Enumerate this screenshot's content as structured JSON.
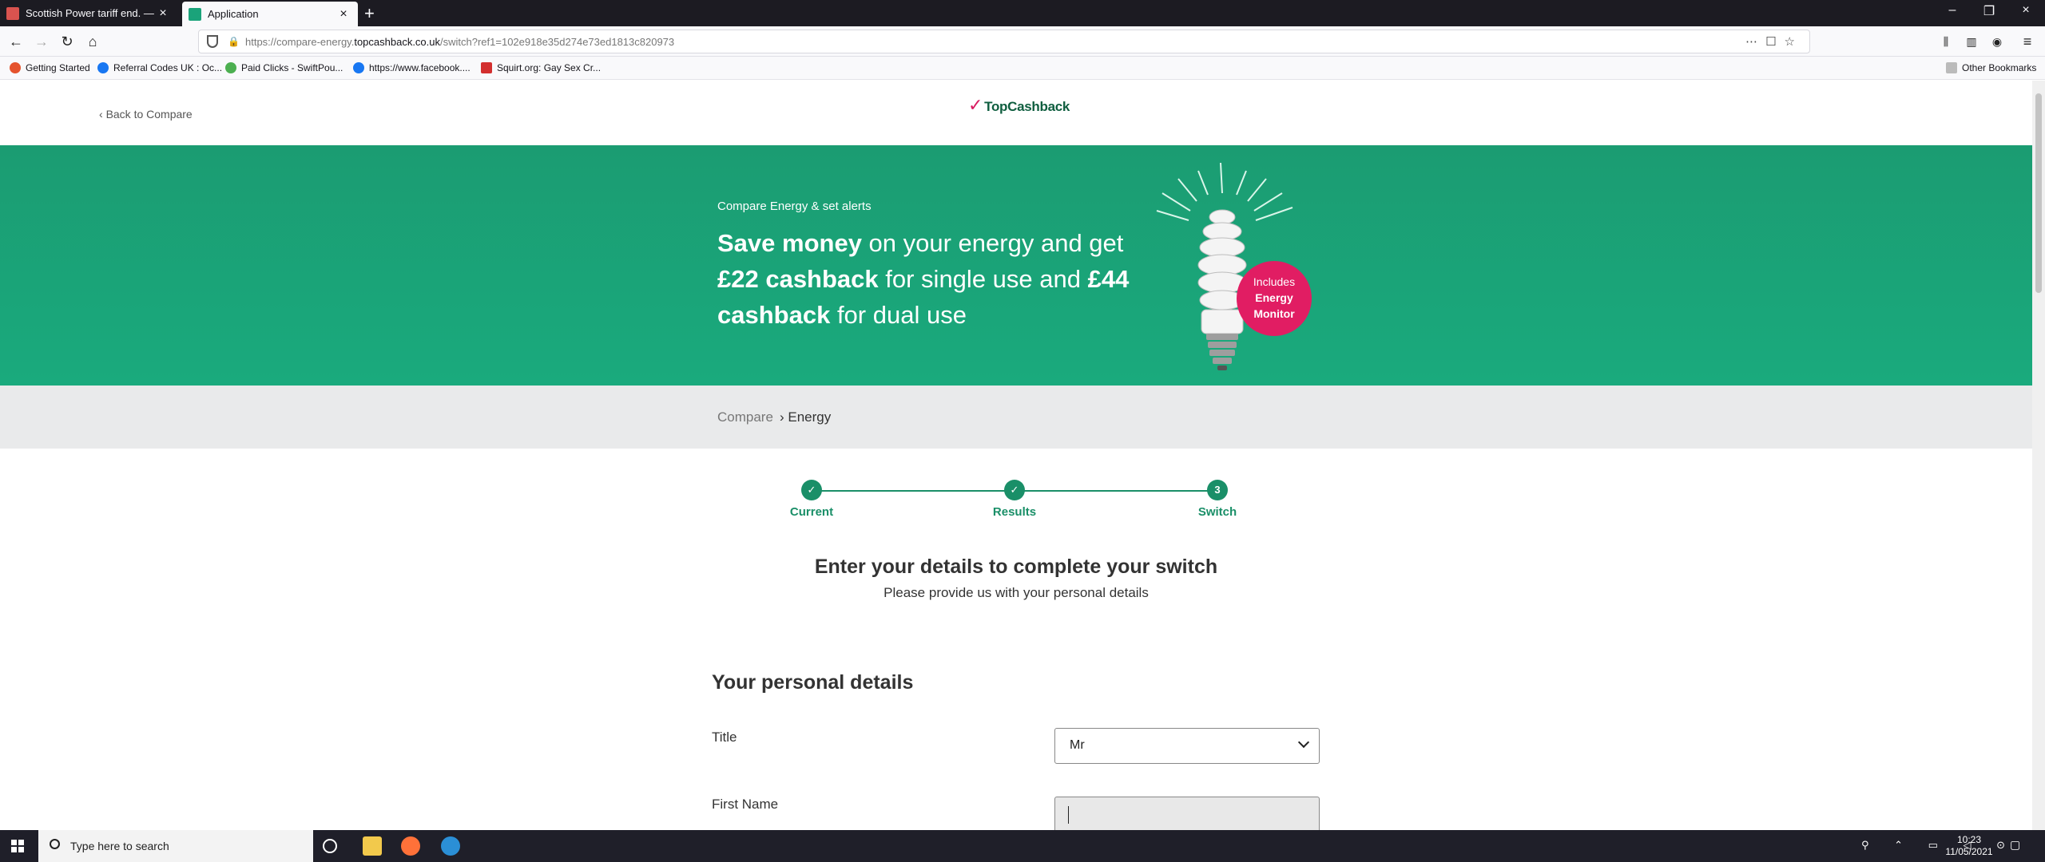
{
  "browser": {
    "tabs": [
      {
        "title": "Scottish Power tariff end. — M"
      },
      {
        "title": "Application"
      }
    ],
    "url": {
      "prefix": "https://compare-energy.",
      "domain": "topcashback.co.uk",
      "path": "/switch?ref1=102e918e35d274e73ed1813c820973"
    },
    "bookmarks": [
      {
        "label": "Getting Started"
      },
      {
        "label": "Referral Codes UK : Oc..."
      },
      {
        "label": "Paid Clicks - SwiftPou..."
      },
      {
        "label": "https://www.facebook...."
      },
      {
        "label": "Squirt.org: Gay Sex Cr..."
      }
    ],
    "other_bookmarks": "Other Bookmarks"
  },
  "site": {
    "back_link": "Back to Compare",
    "logo_text": "TopCashback"
  },
  "hero": {
    "eyebrow": "Compare Energy & set alerts",
    "headline": {
      "b1": "Save money",
      "t1": " on your energy and get ",
      "b2": "£22 cashback",
      "t2": " for single use and ",
      "b3": "£44 cashback",
      "t3": " for dual use"
    },
    "badge": {
      "line1": "Includes",
      "line2": "Energy",
      "line3": "Monitor"
    }
  },
  "breadcrumb": {
    "compare": "Compare",
    "energy": "› Energy"
  },
  "stepper": {
    "steps": [
      {
        "label": "Current",
        "marker": "✓"
      },
      {
        "label": "Results",
        "marker": "✓"
      },
      {
        "label": "Switch",
        "marker": "3"
      }
    ]
  },
  "form": {
    "heading": "Enter your details to complete your switch",
    "subheading": "Please provide us with your personal details",
    "section_title": "Your personal details",
    "title_label": "Title",
    "title_value": "Mr",
    "first_name_label": "First Name",
    "first_name_value": ""
  },
  "taskbar": {
    "search_placeholder": "Type here to search",
    "time": "10:23",
    "date": "11/05/2021"
  },
  "colors": {
    "brand_green": "#1aa37a",
    "badge_pink": "#e11d63",
    "step_green": "#1a8f68"
  }
}
